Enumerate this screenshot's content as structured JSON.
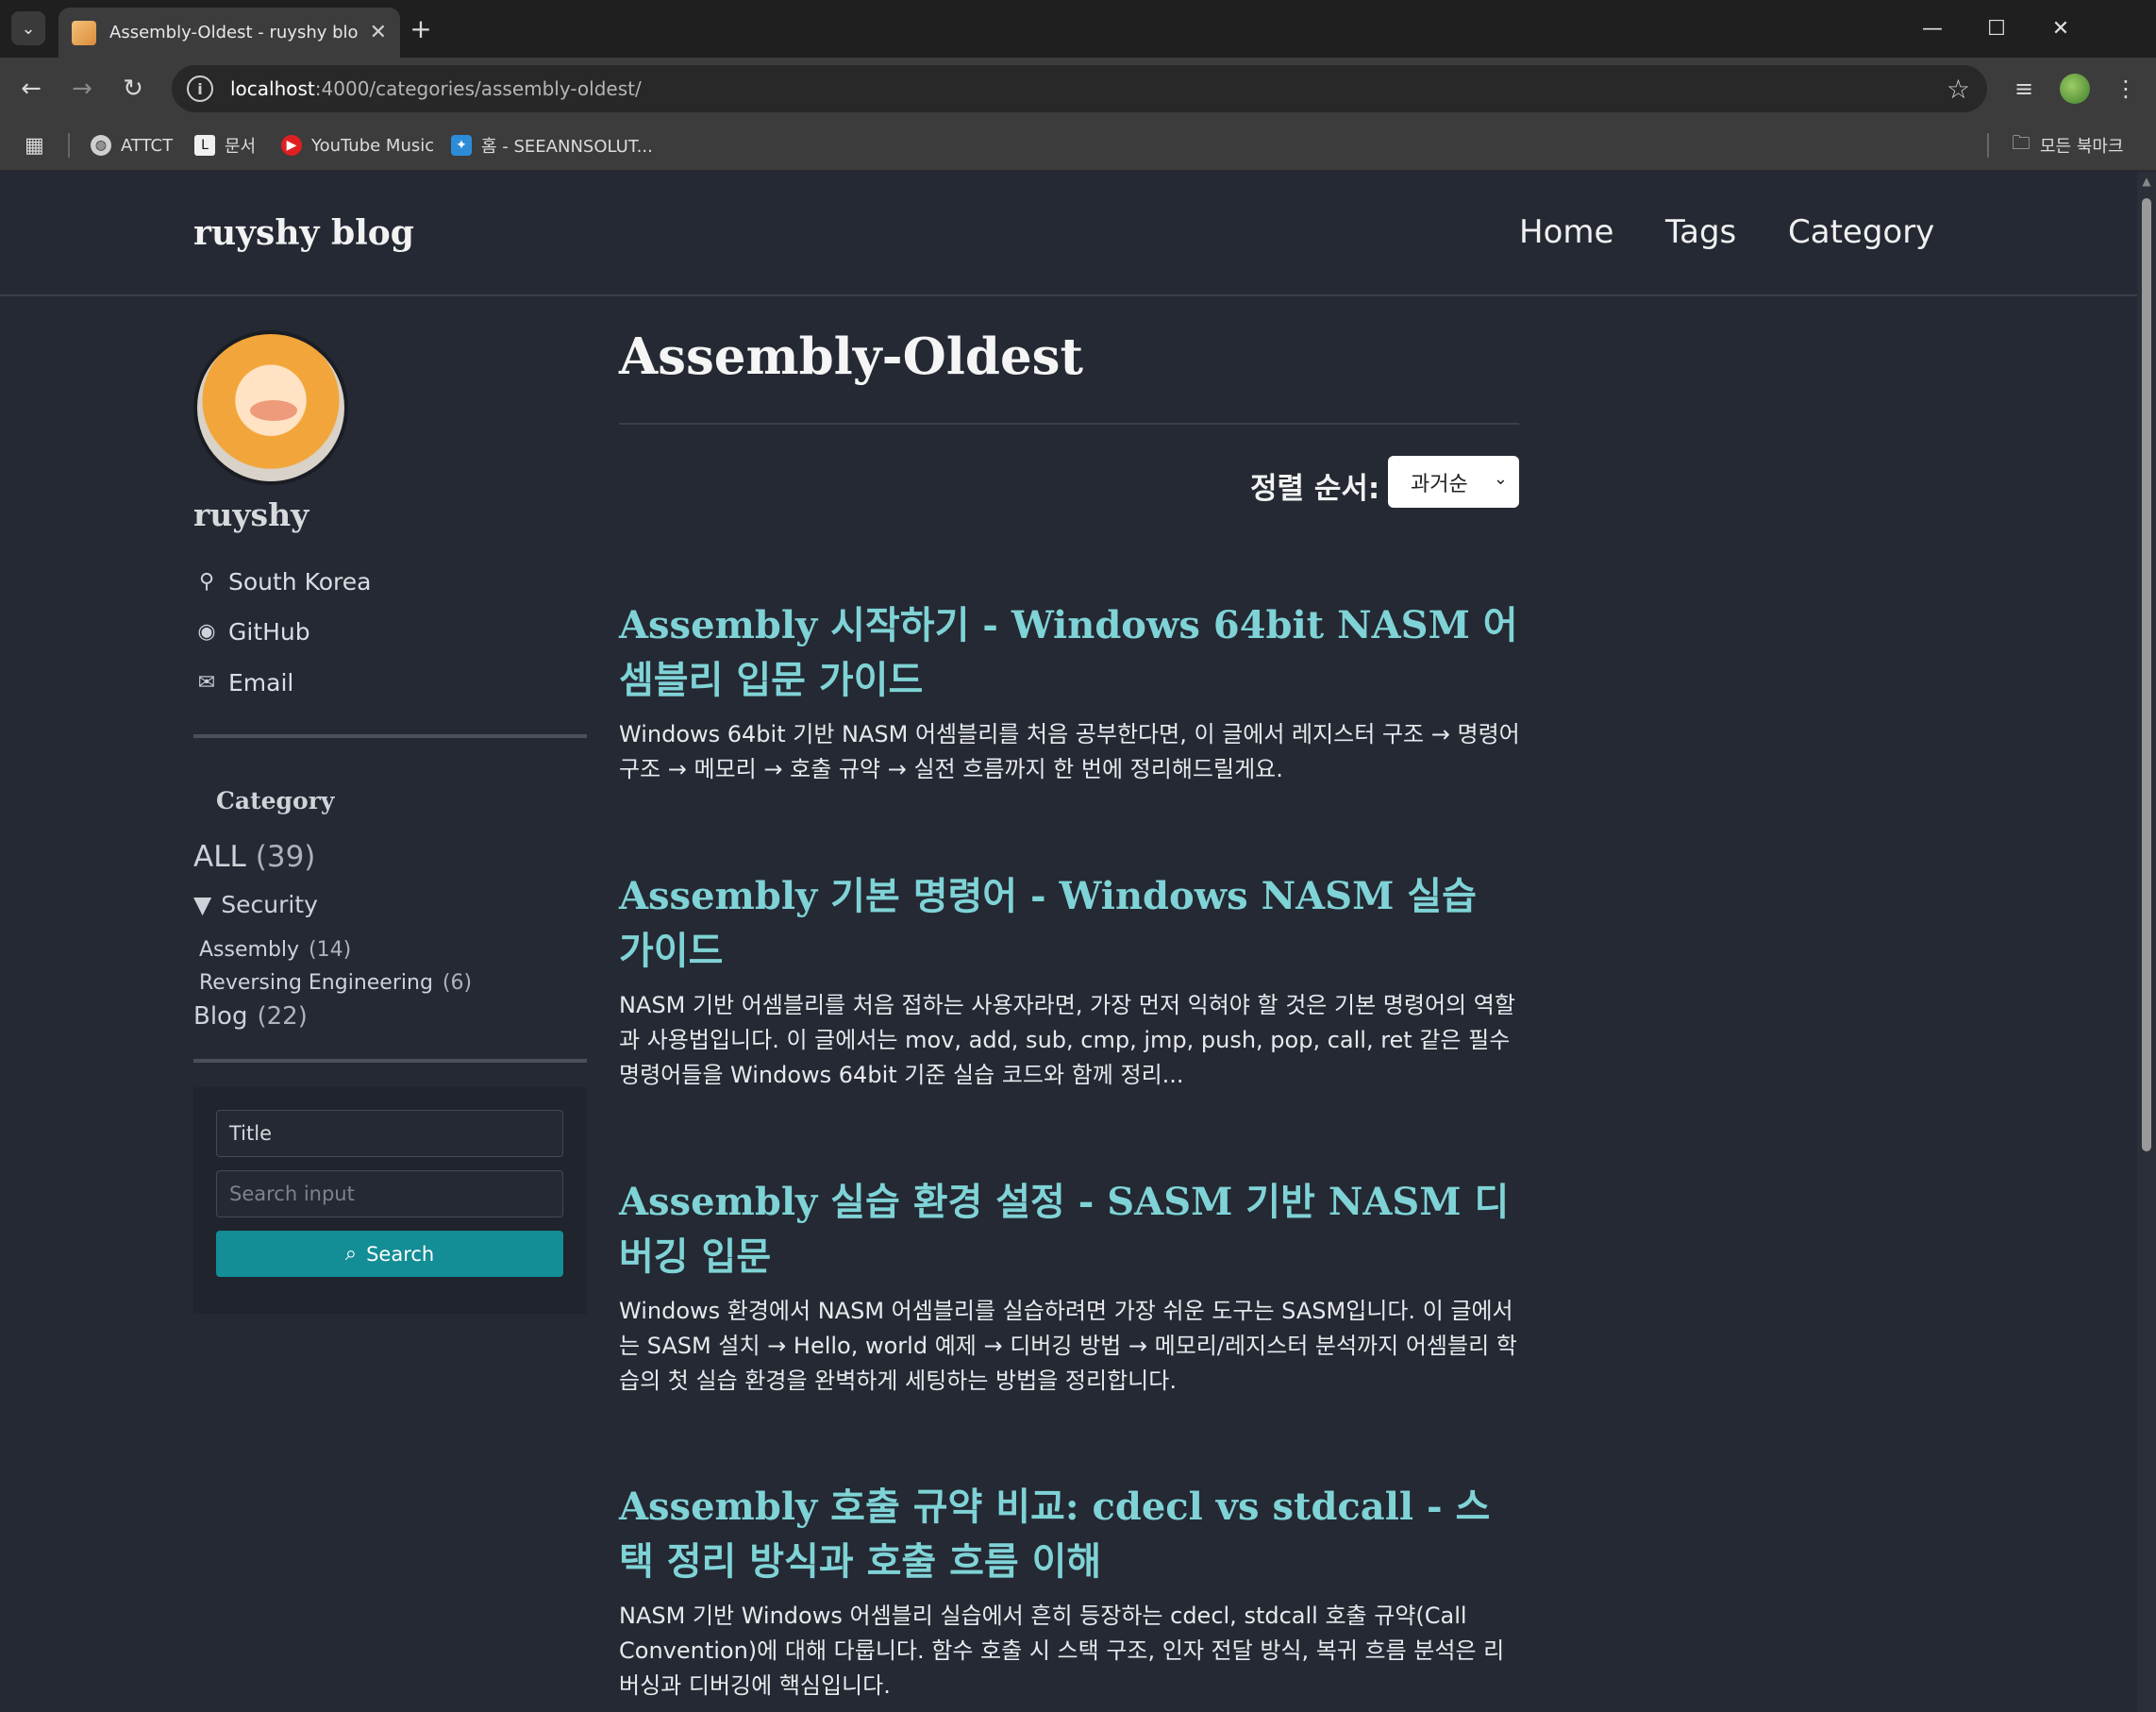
{
  "browser": {
    "tab_title": "Assembly-Oldest - ruyshy blog",
    "url_host": "localhost",
    "url_rest": ":4000/categories/assembly-oldest/",
    "bookmarks": [
      {
        "label": "ATTCT"
      },
      {
        "label": "문서"
      },
      {
        "label": "YouTube Music"
      },
      {
        "label": "홈 - SEEANNSOLUT..."
      }
    ],
    "all_bookmarks_label": "모든 북마크"
  },
  "header": {
    "site_title": "ruyshy blog",
    "nav": [
      "Home",
      "Tags",
      "Category"
    ]
  },
  "author": {
    "name": "ruyshy",
    "location": "South Korea",
    "github": "GitHub",
    "email": "Email"
  },
  "categories": {
    "heading": "Category",
    "all": {
      "label": "ALL",
      "count": "(39)"
    },
    "security": {
      "label": "Security",
      "toggle": "▼"
    },
    "children": [
      {
        "label": "Assembly",
        "count": "(14)"
      },
      {
        "label": "Reversing Engineering",
        "count": "(6)"
      }
    ],
    "blog": {
      "label": "Blog",
      "count": "(22)"
    }
  },
  "search": {
    "field_value": "Title",
    "input_placeholder": "Search input",
    "button_label": "Search"
  },
  "main": {
    "title": "Assembly-Oldest",
    "sort_label": "정렬 순서:",
    "sort_value": "과거순",
    "posts": [
      {
        "title": "Assembly 시작하기 - Windows 64bit NASM 어셈블리 입문 가이드",
        "excerpt": "Windows 64bit 기반 NASM 어셈블리를 처음 공부한다면, 이 글에서 레지스터 구조 → 명령어 구조 → 메모리 → 호출 규약 → 실전 흐름까지 한 번에 정리해드릴게요."
      },
      {
        "title": "Assembly 기본 명령어 - Windows NASM 실습 가이드",
        "excerpt": "NASM 기반 어셈블리를 처음 접하는 사용자라면, 가장 먼저 익혀야 할 것은 기본 명령어의 역할과 사용법입니다. 이 글에서는 mov, add, sub, cmp, jmp, push, pop, call, ret 같은 필수 명령어들을 Windows 64bit 기준 실습 코드와 함께 정리..."
      },
      {
        "title": "Assembly 실습 환경 설정 - SASM 기반 NASM 디버깅 입문",
        "excerpt": "Windows 환경에서 NASM 어셈블리를 실습하려면 가장 쉬운 도구는 SASM입니다. 이 글에서는 SASM 설치 → Hello, world 예제 → 디버깅 방법 → 메모리/레지스터 분석까지 어셈블리 학습의 첫 실습 환경을 완벽하게 세팅하는 방법을 정리합니다."
      },
      {
        "title": "Assembly 호출 규약 비교: cdecl vs stdcall - 스택 정리 방식과 호출 흐름 이해",
        "excerpt": "NASM 기반 Windows 어셈블리 실습에서 흔히 등장하는 cdecl, stdcall 호출 규약(Call Convention)에 대해 다룹니다. 함수 호출 시 스택 구조, 인자 전달 방식, 복귀 흐름 분석은 리버싱과 디버깅에 핵심입니다."
      }
    ]
  }
}
